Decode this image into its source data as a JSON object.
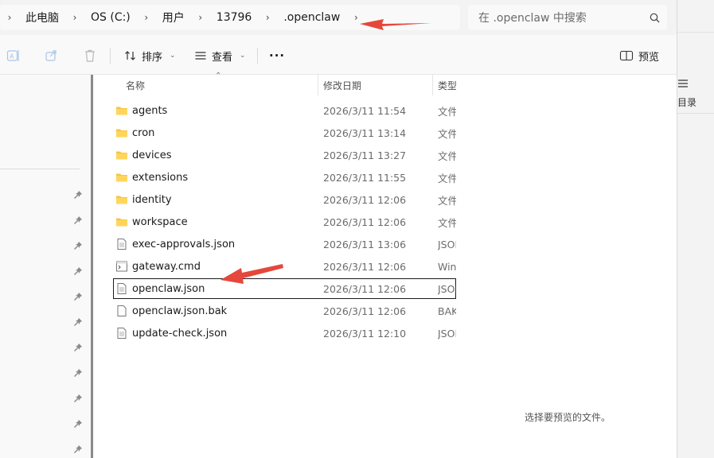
{
  "address": {
    "crumbs": [
      "此电脑",
      "OS (C:)",
      "用户",
      "13796",
      ".openclaw"
    ]
  },
  "search": {
    "placeholder": "在 .openclaw 中搜索"
  },
  "toolbar": {
    "sort_label": "排序",
    "view_label": "查看",
    "more_label": "···",
    "preview_label": "预览"
  },
  "columns": {
    "name": "名称",
    "date": "修改日期",
    "type": "类型"
  },
  "files": [
    {
      "name": "agents",
      "date": "2026/3/11 11:54",
      "type": "文件夹",
      "kind": "folder"
    },
    {
      "name": "cron",
      "date": "2026/3/11 13:14",
      "type": "文件夹",
      "kind": "folder"
    },
    {
      "name": "devices",
      "date": "2026/3/11 13:27",
      "type": "文件夹",
      "kind": "folder"
    },
    {
      "name": "extensions",
      "date": "2026/3/11 11:55",
      "type": "文件夹",
      "kind": "folder"
    },
    {
      "name": "identity",
      "date": "2026/3/11 12:06",
      "type": "文件夹",
      "kind": "folder"
    },
    {
      "name": "workspace",
      "date": "2026/3/11 12:06",
      "type": "文件夹",
      "kind": "folder"
    },
    {
      "name": "exec-approvals.json",
      "date": "2026/3/11 13:06",
      "type": "JSON",
      "kind": "json"
    },
    {
      "name": "gateway.cmd",
      "date": "2026/3/11 12:06",
      "type": "Windows",
      "kind": "cmd"
    },
    {
      "name": "openclaw.json",
      "date": "2026/3/11 12:06",
      "type": "JSON",
      "kind": "json",
      "selected": true
    },
    {
      "name": "openclaw.json.bak",
      "date": "2026/3/11 12:06",
      "type": "BAK",
      "kind": "blank"
    },
    {
      "name": "update-check.json",
      "date": "2026/3/11 12:10",
      "type": "JSON",
      "kind": "json"
    }
  ],
  "preview": {
    "message": "选择要预览的文件。"
  },
  "background_window": {
    "label": "目录"
  },
  "colors": {
    "folder": "#f5c542",
    "annotation": "#e5473c",
    "selection_outline": "#1a1a1a"
  }
}
